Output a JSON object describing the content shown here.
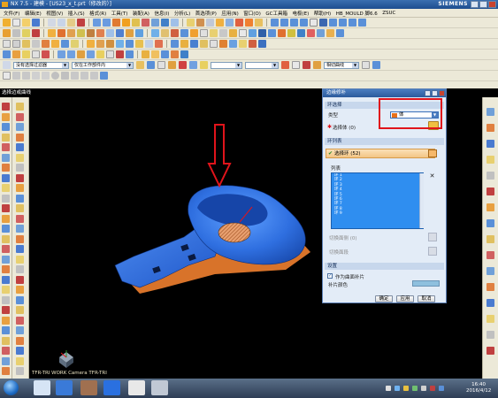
{
  "window": {
    "title": "NX 7.5 - 建模 - [US23_x_t.prt（修改的）]",
    "brand": "SIEMENS"
  },
  "menu": {
    "items": [
      "文件(F)",
      "编辑(E)",
      "视图(V)",
      "插入(S)",
      "格式(R)",
      "工具(T)",
      "装配(A)",
      "信息(I)",
      "分析(L)",
      "首选项(P)",
      "应用(N)",
      "窗口(O)",
      "GC工具箱",
      "电极(E)",
      "帮助(H)",
      "HB_MOULD 脚6.6",
      "ZSUC"
    ],
    "brand": "SIEMENS"
  },
  "selection_bar": {
    "filter": "没有选择过滤器",
    "scope": "仅在工作部件内",
    "curve_rule": "相切曲线"
  },
  "viewport": {
    "command_title": "选择边或曲线",
    "status": "TFR-TRI WORK Camera TFR-TRI"
  },
  "dialog": {
    "title": "边缘修补",
    "section_ring_select": "环选择",
    "type_label": "类型",
    "type_value": "体",
    "select_body_label": "选择体 (0)",
    "section_ring_list": "环列表",
    "select_rings_label": "选择环 (52)",
    "list_label": "列表",
    "list_items": [
      "环 1",
      "环 2",
      "环 3",
      "环 4",
      "环 5",
      "环 6",
      "环 7",
      "环 8",
      "环 9"
    ],
    "switch_faces_label": "切换面侧 (0)",
    "traverse_label": "切换面段",
    "section_settings": "设置",
    "as_boundary_label": "作为曲面补片",
    "patch_color_label": "补片颜色",
    "patch_color": "#8fc0de",
    "ok_label": "确定",
    "apply_label": "应用",
    "cancel_label": "取消"
  },
  "taskbar": {
    "time": "16:40",
    "date": "2016/4/12"
  },
  "colors": {
    "part_blue": "#2f6fe0",
    "part_orange": "#d8732a",
    "annotation_red": "#e0141b",
    "list_selected": "#2f8ef0"
  }
}
